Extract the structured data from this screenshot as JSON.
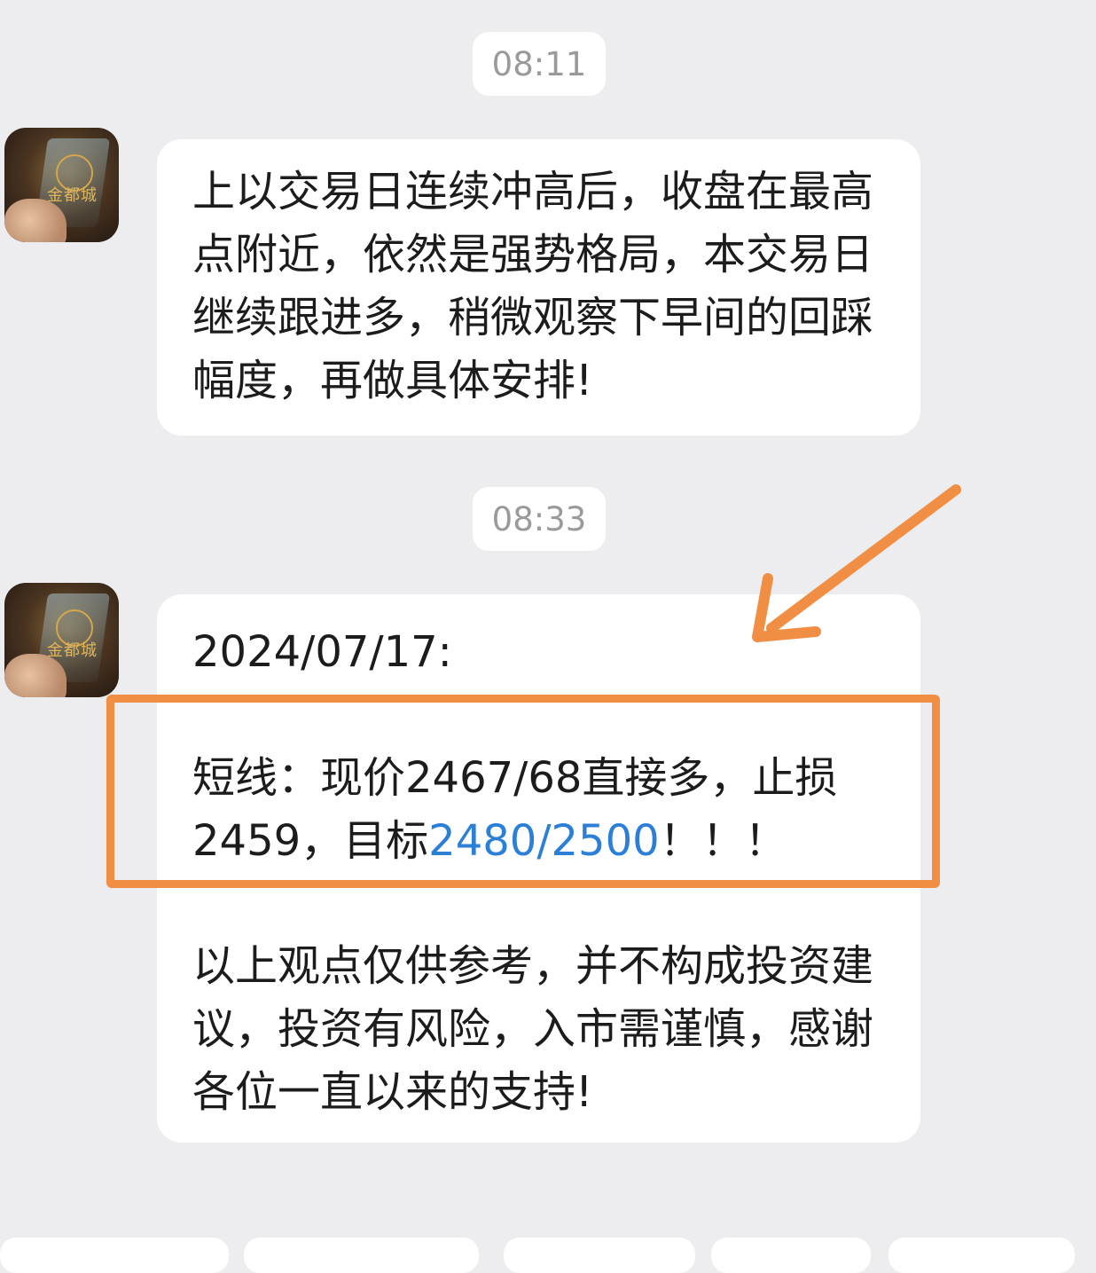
{
  "messages": [
    {
      "time": "08:11",
      "avatar_icon": "sender-avatar",
      "paragraphs": [
        "上以交易日连续冲高后，收盘在最高点附近，依然是强势格局，本交易日继续跟进多，稍微观察下早间的回踩幅度，再做具体安排!"
      ]
    },
    {
      "time": "08:33",
      "avatar_icon": "sender-avatar",
      "date_line": "2024/07/17:",
      "signal_prefix": "短线：现价2467/68直接多，止损2459，目标",
      "signal_link": "2480/2500",
      "signal_suffix": "！！！",
      "disclaimer": "以上观点仅供参考，并不构成投资建议，投资有风险，入市需谨慎，感谢各位一直以来的支持!"
    }
  ],
  "avatar_logo_text": "金都城",
  "colors": {
    "background": "#ededf0",
    "bubble": "#ffffff",
    "link": "#2b7fd6",
    "annotation": "#f08e44"
  }
}
